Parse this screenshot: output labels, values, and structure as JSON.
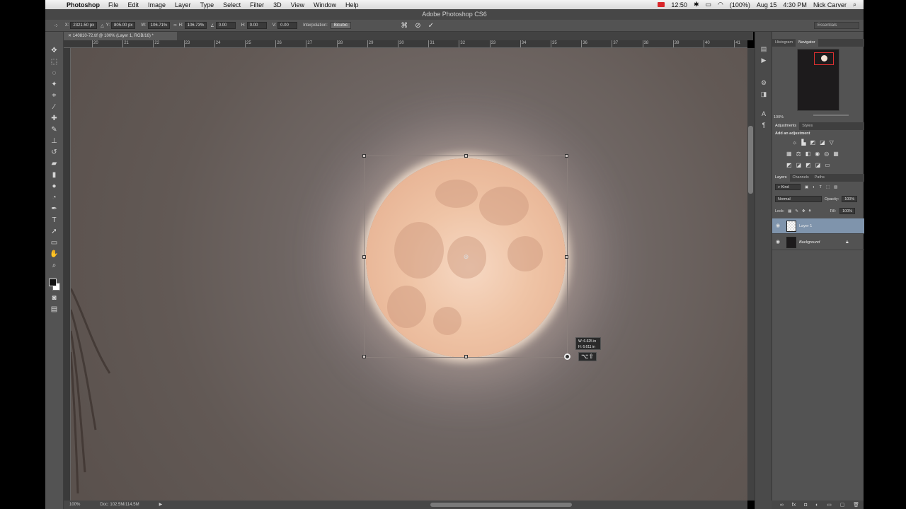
{
  "menubar": {
    "app_name": "Photoshop",
    "items": [
      "File",
      "Edit",
      "Image",
      "Layer",
      "Type",
      "Select",
      "Filter",
      "3D",
      "View",
      "Window",
      "Help"
    ],
    "clock_left": "12:50",
    "battery": "(100%)",
    "date": "Aug 15",
    "time": "4:30 PM",
    "user": "Nick Carver"
  },
  "window": {
    "title": "Adobe Photoshop CS6"
  },
  "options_bar": {
    "x_label": "X:",
    "x_value": "2321.50 px",
    "y_label": "Y:",
    "y_value": "805.00 px",
    "w_label": "W:",
    "w_value": "106.71%",
    "h_label": "H:",
    "h_value": "106.73%",
    "angle_value": "0.00",
    "hskew_label": "H:",
    "hskew_value": "0.00",
    "vskew_label": "V:",
    "vskew_value": "0.00",
    "interp_label": "Interpolation:",
    "interp_value": "Bicubic",
    "workspace": "Essentials"
  },
  "document": {
    "tab_title": "140810-72.tif @ 100% (Layer 1, RGB/16) *",
    "ruler_marks": [
      "20",
      "21",
      "22",
      "23",
      "24",
      "25",
      "26",
      "27",
      "28",
      "29",
      "30",
      "31",
      "32",
      "33",
      "34",
      "35",
      "36",
      "37",
      "38",
      "39",
      "40",
      "41"
    ],
    "zoom": "100%",
    "doc_info": "Doc: 102.5M/114.5M"
  },
  "transform_tooltip": {
    "w": "W: 6.625 in",
    "h": "H: 6.611 in",
    "modifier": "⌥⇧"
  },
  "panels": {
    "nav_tabs": [
      "Histogram",
      "Navigator"
    ],
    "nav_zoom": "100%",
    "adj_tabs": [
      "Adjustments",
      "Styles"
    ],
    "adj_heading": "Add an adjustment",
    "layer_tabs": [
      "Layers",
      "Channels",
      "Paths"
    ],
    "kind_filter": "Kind",
    "blend_mode": "Normal",
    "opacity_label": "Opacity:",
    "opacity_value": "100%",
    "lock_label": "Lock:",
    "fill_label": "Fill:",
    "fill_value": "100%",
    "layers": [
      {
        "name": "Layer 1",
        "selected": true
      },
      {
        "name": "Background",
        "selected": false
      }
    ]
  },
  "colors": {
    "foreground": "#111111",
    "background": "#ffffff",
    "accent_selection": "#7f94ac"
  }
}
